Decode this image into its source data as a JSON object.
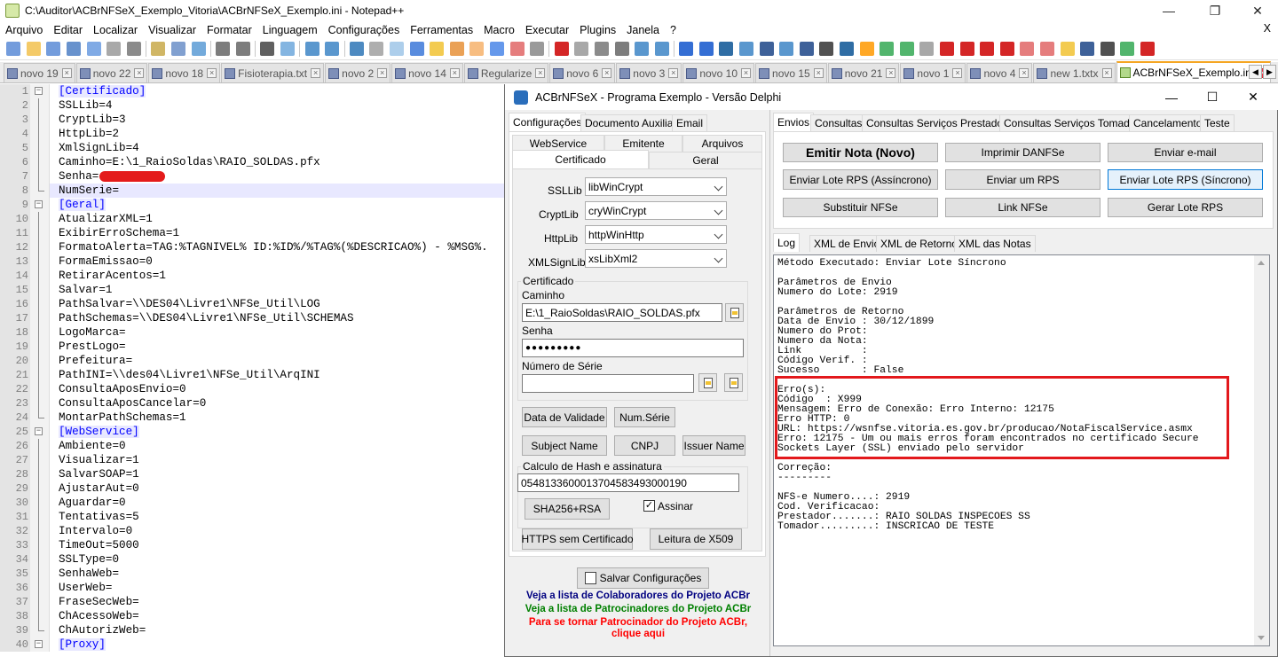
{
  "npp": {
    "title": "C:\\Auditor\\ACBrNFSeX_Exemplo_Vitoria\\ACBrNFSeX_Exemplo.ini - Notepad++",
    "menu": [
      "Arquivo",
      "Editar",
      "Localizar",
      "Visualizar",
      "Formatar",
      "Linguagem",
      "Configurações",
      "Ferramentas",
      "Macro",
      "Executar",
      "Plugins",
      "Janela",
      "?"
    ],
    "menu_close": "X",
    "tabs": [
      "novo 19",
      "novo 22",
      "novo 18",
      "Fisioterapia.txt",
      "novo 2",
      "novo 14",
      "Regularize",
      "novo 6",
      "novo 3",
      "novo 10",
      "novo 15",
      "novo 21",
      "novo 1",
      "novo 4",
      "new 1.txtx",
      "ACBrNFSeX_Exemplo.ini"
    ],
    "active_tab": 15
  },
  "editor": {
    "lines": [
      {
        "n": "1",
        "t": "[Certificado]",
        "sec": true,
        "fold": "open"
      },
      {
        "n": "2",
        "t": "SSLLib=4"
      },
      {
        "n": "3",
        "t": "CryptLib=3"
      },
      {
        "n": "4",
        "t": "HttpLib=2"
      },
      {
        "n": "5",
        "t": "XmlSignLib=4"
      },
      {
        "n": "6",
        "t": "Caminho=E:\\1_RaioSoldas\\RAIO_SOLDAS.pfx"
      },
      {
        "n": "7",
        "t": "Senha=",
        "redacted": true
      },
      {
        "n": "8",
        "t": "NumSerie=",
        "cur": true,
        "fold": "end"
      },
      {
        "n": "9",
        "t": "[Geral]",
        "sec": true,
        "fold": "open"
      },
      {
        "n": "10",
        "t": "AtualizarXML=1"
      },
      {
        "n": "11",
        "t": "ExibirErroSchema=1"
      },
      {
        "n": "12",
        "t": "FormatoAlerta=TAG:%TAGNIVEL% ID:%ID%/%TAG%(%DESCRICAO%) - %MSG%."
      },
      {
        "n": "13",
        "t": "FormaEmissao=0"
      },
      {
        "n": "14",
        "t": "RetirarAcentos=1"
      },
      {
        "n": "15",
        "t": "Salvar=1"
      },
      {
        "n": "16",
        "t": "PathSalvar=\\\\DES04\\Livre1\\NFSe_Util\\LOG"
      },
      {
        "n": "17",
        "t": "PathSchemas=\\\\DES04\\Livre1\\NFSe_Util\\SCHEMAS"
      },
      {
        "n": "18",
        "t": "LogoMarca="
      },
      {
        "n": "19",
        "t": "PrestLogo="
      },
      {
        "n": "20",
        "t": "Prefeitura="
      },
      {
        "n": "21",
        "t": "PathINI=\\\\des04\\Livre1\\NFSe_Util\\ArqINI"
      },
      {
        "n": "22",
        "t": "ConsultaAposEnvio=0"
      },
      {
        "n": "23",
        "t": "ConsultaAposCancelar=0"
      },
      {
        "n": "24",
        "t": "MontarPathSchemas=1",
        "fold": "end"
      },
      {
        "n": "25",
        "t": "[WebService]",
        "sec": true,
        "fold": "open"
      },
      {
        "n": "26",
        "t": "Ambiente=0"
      },
      {
        "n": "27",
        "t": "Visualizar=1"
      },
      {
        "n": "28",
        "t": "SalvarSOAP=1"
      },
      {
        "n": "29",
        "t": "AjustarAut=0"
      },
      {
        "n": "30",
        "t": "Aguardar=0"
      },
      {
        "n": "31",
        "t": "Tentativas=5"
      },
      {
        "n": "32",
        "t": "Intervalo=0"
      },
      {
        "n": "33",
        "t": "TimeOut=5000"
      },
      {
        "n": "34",
        "t": "SSLType=0"
      },
      {
        "n": "35",
        "t": "SenhaWeb="
      },
      {
        "n": "36",
        "t": "UserWeb="
      },
      {
        "n": "37",
        "t": "FraseSecWeb="
      },
      {
        "n": "38",
        "t": "ChAcessoWeb="
      },
      {
        "n": "39",
        "t": "ChAutorizWeb=",
        "fold": "end"
      },
      {
        "n": "40",
        "t": "[Proxy]",
        "sec": true,
        "fold": "open"
      }
    ]
  },
  "acbr": {
    "title": "ACBrNFSeX - Programa Exemplo - Versão Delphi",
    "left_tabs": [
      "Configurações",
      "Documento Auxiliar",
      "Email"
    ],
    "sub_tabs_row1": [
      "WebService",
      "Emitente",
      "Arquivos"
    ],
    "sub_tabs_row2": [
      "Certificado",
      "Geral"
    ],
    "ssllib_label": "SSLLib",
    "ssllib_value": "libWinCrypt",
    "cryptlib_label": "CryptLib",
    "cryptlib_value": "cryWinCrypt",
    "httplib_label": "HttpLib",
    "httplib_value": "httpWinHttp",
    "xmlsignlib_label": "XMLSignLib",
    "xmlsignlib_value": "xsLibXml2",
    "cert_group": "Certificado",
    "caminho_label": "Caminho",
    "caminho_value": "E:\\1_RaioSoldas\\RAIO_SOLDAS.pfx",
    "senha_label": "Senha",
    "senha_value": "●●●●●●●●●",
    "numserie_label": "Número de Série",
    "numserie_value": "",
    "btn_data_validade": "Data de Validade",
    "btn_num_serie": "Num.Série",
    "btn_subject": "Subject Name",
    "btn_cnpj": "CNPJ",
    "btn_issuer": "Issuer Name",
    "hash_group": "Calculo de Hash e assinatura",
    "hash_value": "05481336000137045834930001​90",
    "btn_sha": "SHA256+RSA",
    "assinar_label": "Assinar",
    "btn_https": "HTTPS sem Certificado",
    "btn_x509": "Leitura de X509",
    "btn_salvar": "Salvar Configurações",
    "link1": "Veja a lista de Colaboradores do Projeto ACBr",
    "link2": "Veja a lista de Patrocinadores do Projeto ACBr",
    "link3a": "Para se tornar Patrocinador do Projeto ACBr,",
    "link3b": "clique aqui",
    "colors": {
      "link1": "#000080",
      "link2": "#008000",
      "link3": "#ff0000",
      "highlight": "#e3191c"
    },
    "right_tabs": [
      "Envios",
      "Consultas",
      "Consultas Serviços Prestados",
      "Consultas Serviços Tomados",
      "Cancelamento",
      "Teste"
    ],
    "btn_emitir": "Emitir Nota (Novo)",
    "btn_imprimir": "Imprimir DANFSe",
    "btn_enviar_email": "Enviar e-mail",
    "btn_lote_assinc": "Enviar Lote RPS (Assíncrono)",
    "btn_enviar_rps": "Enviar um RPS",
    "btn_lote_sinc": "Enviar Lote RPS (Síncrono)",
    "btn_substituir": "Substituir NFSe",
    "btn_link": "Link NFSe",
    "btn_gerar_lote": "Gerar Lote RPS",
    "log_tabs": [
      "Log",
      "XML de Envio",
      "XML de Retorno",
      "XML das Notas"
    ],
    "log_text": "Método Executado: Enviar Lote Síncrono\n\nParâmetros de Envio\nNumero do Lote: 2919\n\nParâmetros de Retorno\nData de Envio : 30/12/1899\nNumero do Prot:\nNumero da Nota:\nLink          :\nCódigo Verif. :\nSucesso       : False\n\nErro(s):\nCódigo  : X999\nMensagem: Erro de Conexão: Erro Interno: 12175\nErro HTTP: 0\nURL: https://wsnfse.vitoria.es.gov.br/producao/NotaFiscalService.asmx\nErro: 12175 - Um ou mais erros foram encontrados no certificado Secure\nSockets Layer (SSL) enviado pelo servidor\n\nCorreção:\n---------\n\nNFS-e Numero....: 2919\nCod. Verificacao:\nPrestador.......: RAIO SOLDAS INSPECOES SS\nTomador.........: INSCRICAO DE TESTE"
  }
}
